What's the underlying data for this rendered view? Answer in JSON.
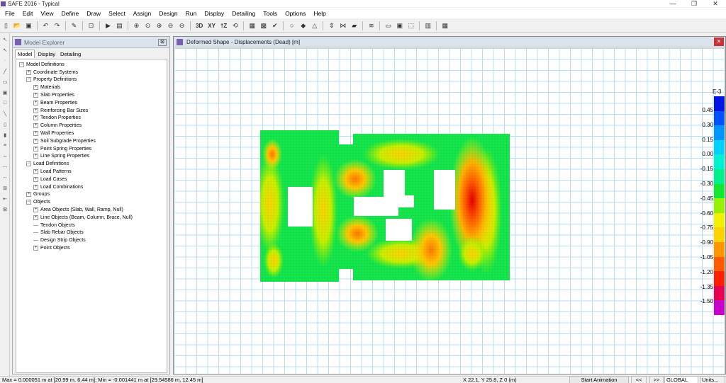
{
  "window": {
    "title": "SAFE 2016 - Typical",
    "controls": [
      "—",
      "❐",
      "✕"
    ]
  },
  "menu": [
    "File",
    "Edit",
    "View",
    "Define",
    "Draw",
    "Select",
    "Assign",
    "Design",
    "Run",
    "Display",
    "Detailing",
    "Tools",
    "Options",
    "Help"
  ],
  "toolbar": {
    "view_3d": "3D",
    "view_xy": "XY",
    "view_tz": "†Z"
  },
  "explorer": {
    "title": "Model Explorer",
    "close": "⊠",
    "tabs": [
      "Model",
      "Display",
      "Detailing"
    ],
    "tree": [
      {
        "label": "Model Definitions",
        "level": 0,
        "toggle": "−"
      },
      {
        "label": "Coordinate Systems",
        "level": 1,
        "toggle": "+"
      },
      {
        "label": "Property Definitions",
        "level": 1,
        "toggle": "−"
      },
      {
        "label": "Materials",
        "level": 2,
        "toggle": "+"
      },
      {
        "label": "Slab Properties",
        "level": 2,
        "toggle": "+"
      },
      {
        "label": "Beam Properties",
        "level": 2,
        "toggle": "+"
      },
      {
        "label": "Reinforcing Bar Sizes",
        "level": 2,
        "toggle": "+"
      },
      {
        "label": "Tendon Properties",
        "level": 2,
        "toggle": "+"
      },
      {
        "label": "Column Properties",
        "level": 2,
        "toggle": "+"
      },
      {
        "label": "Wall Properties",
        "level": 2,
        "toggle": "+"
      },
      {
        "label": "Soil Subgrade Properties",
        "level": 2,
        "toggle": "+"
      },
      {
        "label": "Point Spring Properties",
        "level": 2,
        "toggle": "+"
      },
      {
        "label": "Line Spring Properties",
        "level": 2,
        "toggle": "+"
      },
      {
        "label": "Load Definitions",
        "level": 1,
        "toggle": "−"
      },
      {
        "label": "Load Patterns",
        "level": 2,
        "toggle": "+"
      },
      {
        "label": "Load Cases",
        "level": 2,
        "toggle": "+"
      },
      {
        "label": "Load Combinations",
        "level": 2,
        "toggle": "+"
      },
      {
        "label": "Groups",
        "level": 1,
        "toggle": "+"
      },
      {
        "label": "Objects",
        "level": 1,
        "toggle": "−"
      },
      {
        "label": "Area Objects (Slab, Wall, Ramp, Null)",
        "level": 2,
        "toggle": "+"
      },
      {
        "label": "Line Objects (Beam, Column, Brace, Null)",
        "level": 2,
        "toggle": "+"
      },
      {
        "label": "Tendon Objects",
        "level": 2,
        "toggle": ""
      },
      {
        "label": "Slab Rebar Objects",
        "level": 2,
        "toggle": ""
      },
      {
        "label": "Design Strip Objects",
        "level": 2,
        "toggle": ""
      },
      {
        "label": "Point Objects",
        "level": 2,
        "toggle": "+"
      }
    ]
  },
  "plot": {
    "title": "Deformed Shape - Displacements (Dead)  [m]",
    "close": "✕"
  },
  "legend": {
    "unit": "E-3",
    "labels": [
      "0.45",
      "0.30",
      "0.15",
      "0.00",
      "-0.15",
      "-0.30",
      "-0.45",
      "-0.60",
      "-0.75",
      "-0.90",
      "-1.05",
      "-1.20",
      "-1.35",
      "-1.50"
    ],
    "colors": [
      "#0014e6",
      "#0050ff",
      "#0096ff",
      "#00d2ff",
      "#00f0d2",
      "#00f08c",
      "#14e632",
      "#96f000",
      "#f0f000",
      "#ffd200",
      "#ff9600",
      "#ff5a00",
      "#ff1e00",
      "#e60050",
      "#c800c8"
    ]
  },
  "status": {
    "message": "Max = 0.000051 m at [20.99 m, 6.44 m];  Min = -0.001441 m at [29.54586 m, 12.45 m]",
    "coords": "X 22.1,  Y 25.8,  Z 0   (m)",
    "start_animation": "Start Animation",
    "prev": "<<",
    "next": ">>",
    "coord_system": "GLOBAL",
    "units": "Units..."
  },
  "contour": {
    "max_value": 5.1e-05,
    "min_value": -0.001441,
    "max_location_m": [
      20.99,
      6.44
    ],
    "min_location_m": [
      29.54586,
      12.45
    ]
  }
}
